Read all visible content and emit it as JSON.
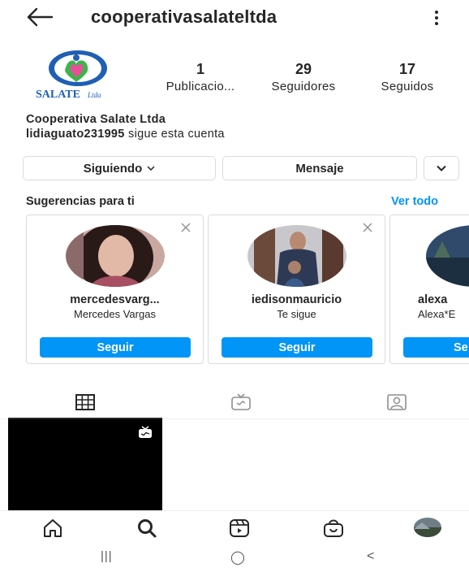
{
  "header": {
    "title": "cooperativasalateltda",
    "back_icon": "arrow-left-icon",
    "menu_icon": "kebab-menu-icon"
  },
  "profile": {
    "avatar_logo_text": "SALATE Ltda",
    "stats": [
      {
        "value": "1",
        "label": "Publicacio..."
      },
      {
        "value": "29",
        "label": "Seguidores"
      },
      {
        "value": "17",
        "label": "Seguidos"
      }
    ],
    "name": "Cooperativa Salate Ltda",
    "followed_by_user": "lidiaguato231995",
    "followed_by_text": "sigue esta cuenta"
  },
  "actions": {
    "following": "Siguiendo",
    "message": "Mensaje"
  },
  "suggestions": {
    "title": "Sugerencias para ti",
    "see_all": "Ver todo",
    "cards": [
      {
        "username": "mercedesvarg...",
        "subtitle": "Mercedes Vargas",
        "button": "Seguir"
      },
      {
        "username": "iedisonmauricio",
        "subtitle": "Te sigue",
        "button": "Seguir"
      },
      {
        "username": "alexa",
        "subtitle": "Alexa*E",
        "button": "Se"
      }
    ]
  },
  "tabs": [
    "grid-icon",
    "igtv-icon",
    "tagged-icon"
  ],
  "bottom_nav": [
    "home-icon",
    "search-icon",
    "reels-icon",
    "shop-icon",
    "profile-avatar"
  ],
  "system_nav": {
    "recents": "|||",
    "home": "◯",
    "back": "<"
  },
  "colors": {
    "accent": "#0095f6",
    "text": "#262626",
    "border": "#dbdbdb"
  }
}
